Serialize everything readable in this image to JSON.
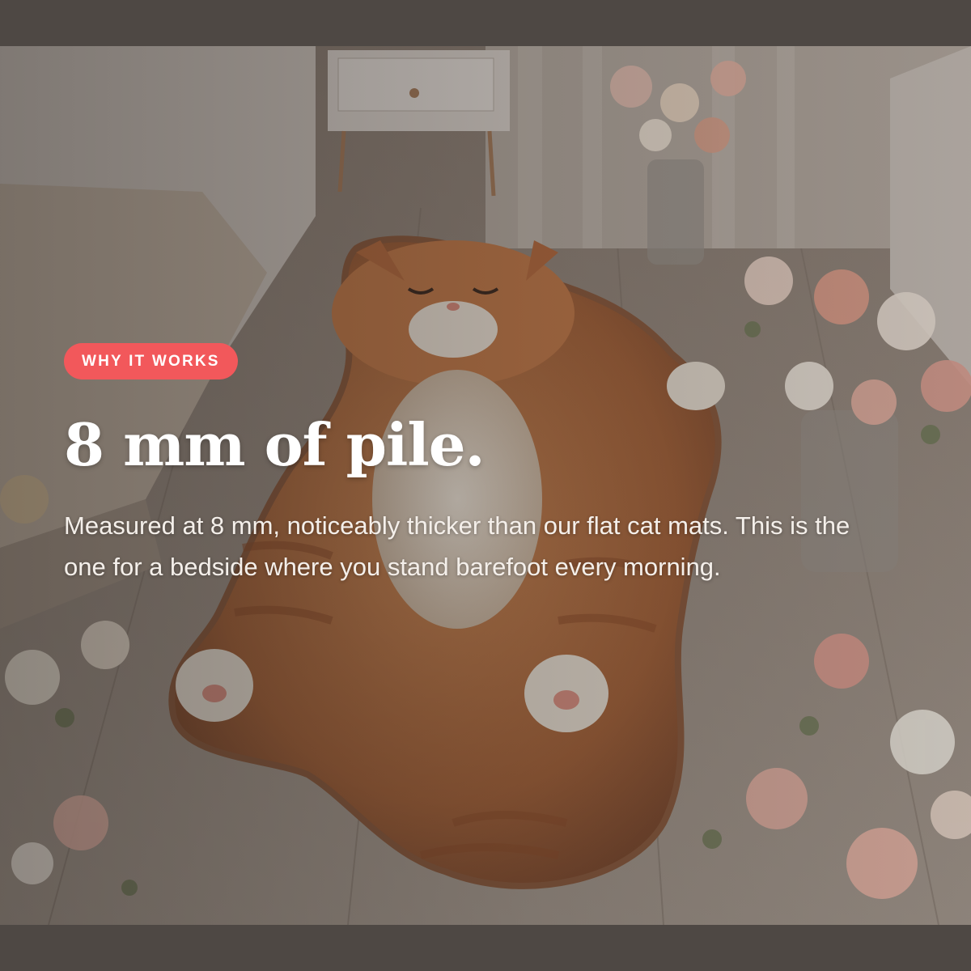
{
  "section": {
    "eyebrow": "WHY IT WORKS",
    "headline": "8 mm of pile.",
    "description": "Measured at 8 mm, noticeably thicker than our flat cat mats. This is the one for a bedside where you stand barefoot every morning."
  },
  "background_image": {
    "icon": "cat-rug-bedroom-photo"
  },
  "colors": {
    "page_background": "#4e4844",
    "badge": "#f2585b",
    "text": "#ffffff"
  }
}
